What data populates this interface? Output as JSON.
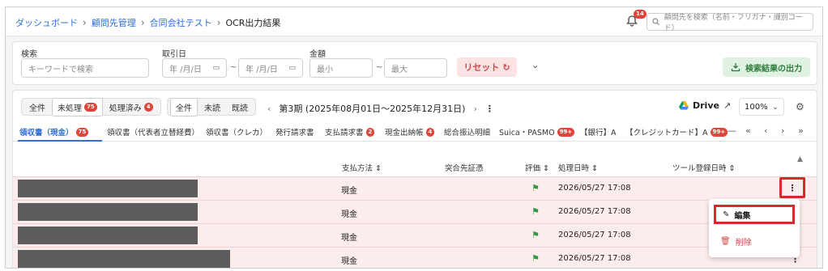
{
  "breadcrumb": {
    "items": [
      "ダッシュボード",
      "顧問先管理",
      "合同会社テスト",
      "OCR出力結果"
    ]
  },
  "header": {
    "notification_count": "14",
    "search_placeholder": "顧問先を検索（名前・フリガナ・識別コード）"
  },
  "filters": {
    "keyword_label": "検索",
    "keyword_placeholder": "キーワードで検索",
    "date_label": "取引日",
    "date_from_placeholder": "年 /月/日",
    "date_to_placeholder": "年 /月/日",
    "amount_label": "金額",
    "amount_min_placeholder": "最小",
    "amount_max_placeholder": "最大",
    "range_sep": "~",
    "reset_label": "リセット",
    "export_label": "検索結果の出力"
  },
  "status_toggle": {
    "all": "全件",
    "unprocessed": "未処理",
    "unprocessed_count": "75",
    "processed": "処理済み",
    "processed_count": "4"
  },
  "read_toggle": {
    "all": "全件",
    "unread": "未読",
    "read": "既読"
  },
  "period": {
    "label": "第3期 (2025年08月01日〜2025年12月31日)"
  },
  "toolbar": {
    "drive_label": "Drive",
    "zoom_label": "100%"
  },
  "tabs": [
    {
      "label": "領収書（現金）",
      "badge": "75"
    },
    {
      "label": "領収書（代表者立替経費）",
      "badge": ""
    },
    {
      "label": "領収書（クレカ）",
      "badge": ""
    },
    {
      "label": "発行請求書",
      "badge": ""
    },
    {
      "label": "支払請求書",
      "badge": "2"
    },
    {
      "label": "現金出納帳",
      "badge": "4"
    },
    {
      "label": "総合振込明細",
      "badge": ""
    },
    {
      "label": "Suica・PASMO",
      "badge": "99+"
    },
    {
      "label": "【銀行】A",
      "badge": ""
    },
    {
      "label": "【クレジットカード】A",
      "badge": "99+"
    }
  ],
  "table": {
    "columns": [
      "支払方法",
      "突合先証憑",
      "評価",
      "処理日時",
      "ツール登録日時"
    ],
    "rows": [
      {
        "payment": "現金",
        "processed_at": "2026/05/27 17:08"
      },
      {
        "payment": "現金",
        "processed_at": "2026/05/27 17:08"
      },
      {
        "payment": "現金",
        "processed_at": "2026/05/27 17:08"
      },
      {
        "payment": "現金",
        "processed_at": "2026/05/27 17:08"
      }
    ]
  },
  "row_menu": {
    "edit_label": "編集",
    "delete_label": "削除"
  },
  "colors": {
    "accent": "#2f6fd6",
    "row_bg": "#fdecec",
    "highlight": "#d42a2a",
    "success": "#2e9a3e"
  }
}
